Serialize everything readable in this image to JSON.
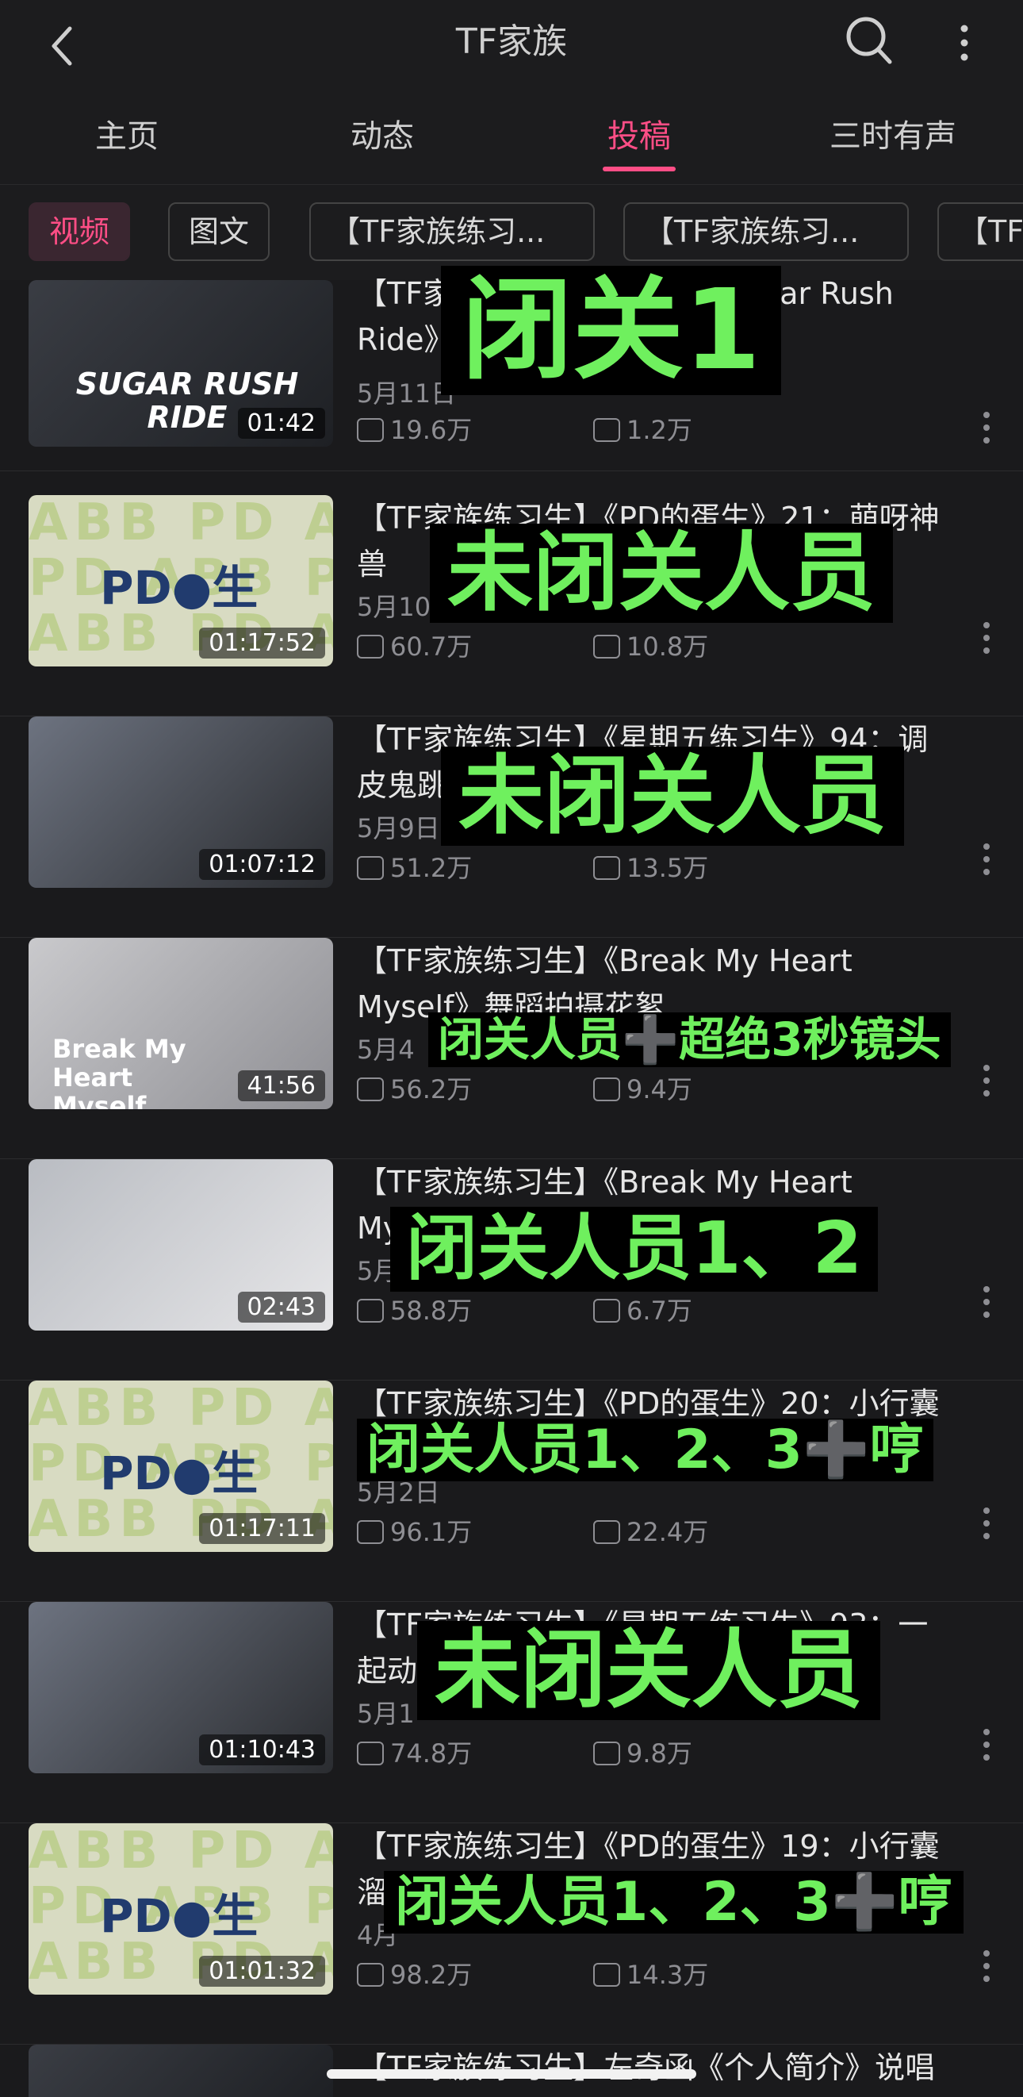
{
  "header": {
    "title": "TF家族"
  },
  "tabs": [
    {
      "label": "主页"
    },
    {
      "label": "动态"
    },
    {
      "label": "投稿"
    },
    {
      "label": "三时有声"
    }
  ],
  "chips": [
    {
      "label": "视频"
    },
    {
      "label": "图文"
    },
    {
      "label": "【TF家族练习..."
    },
    {
      "label": "【TF家族练习..."
    },
    {
      "label": "【TF"
    }
  ],
  "videos": [
    {
      "title": "【TF家族练习生】《Sugar Rush Ride》",
      "title_visible_left": "【TF家",
      "title_visible_right": "gar Rush",
      "title_line2": "Ride》",
      "date": "5月11日",
      "plays": "19.6万",
      "comments": "1.2万",
      "duration": "01:42",
      "thumb_text": "SUGAR RUSH RIDE",
      "overlay": "闭关1"
    },
    {
      "title": "【TF家族练习生】《PD的蛋生》21：萌呀神兽",
      "title_line1": "【TF家族练习生】《PD的蛋生》21：萌呀神",
      "title_line2": "兽",
      "date": "5月10",
      "plays": "60.7万",
      "comments": "10.8万",
      "duration": "01:17:52",
      "overlay": "未闭关人员"
    },
    {
      "title": "【TF家族练习生】《星期五练习生》94：调皮鬼跳",
      "title_line1": "【TF家族练习生】《星期五练习生》94：调",
      "title_line2": "皮鬼跳",
      "date": "5月9日",
      "plays": "51.2万",
      "comments": "13.5万",
      "duration": "01:07:12",
      "overlay": "未闭关人员"
    },
    {
      "title": "【TF家族练习生】《Break My Heart Myself》舞蹈拍摄花絮",
      "title_line1": "【TF家族练习生】《Break My Heart",
      "title_line2": "Myself》舞蹈拍摄花絮",
      "date": "5月4",
      "plays": "56.2万",
      "comments": "9.4万",
      "duration": "41:56",
      "thumb_text": "Break My Heart Myself",
      "overlay": "闭关人员➕超绝3秒镜头"
    },
    {
      "title": "【TF家族练习生】《Break My Heart",
      "title_line1": "【TF家族练习生】《Break My Heart",
      "title_line2": "My",
      "date": "5月",
      "plays": "58.8万",
      "comments": "6.7万",
      "duration": "02:43",
      "overlay": "闭关人员1、2"
    },
    {
      "title": "【TF家族练习生】《PD的蛋生》20：小行囊",
      "title_line1": "【TF家族练习生】《PD的蛋生》20：小行囊",
      "date": "5月2日",
      "plays": "96.1万",
      "comments": "22.4万",
      "duration": "01:17:11",
      "overlay": "闭关人员1、2、3➕哼"
    },
    {
      "title": "【TF家族练习生】《星期五练习生》93：一起动",
      "title_line1": "【TF家族练习生】《星期五练习生》93：一",
      "title_line2": "起动",
      "date": "5月1",
      "plays": "74.8万",
      "comments": "9.8万",
      "duration": "01:10:43",
      "overlay": "未闭关人员"
    },
    {
      "title": "【TF家族练习生】《PD的蛋生》19：小行囊",
      "title_line1": "【TF家族练习生】《PD的蛋生》19：小行囊",
      "title_line2": "溜",
      "date": "4月",
      "plays": "98.2万",
      "comments": "14.3万",
      "duration": "01:01:32",
      "overlay": "闭关人员1、2、3➕哼"
    },
    {
      "title": "【TF家族练习生】左奇函《个人简介》说唱",
      "title_line1": "【TF家族练习生】左奇函《个人简介》说唱"
    }
  ],
  "colors": {
    "accent": "#ff4e86",
    "overlay_text": "#6ff05e",
    "background": "#1a1a1c"
  }
}
